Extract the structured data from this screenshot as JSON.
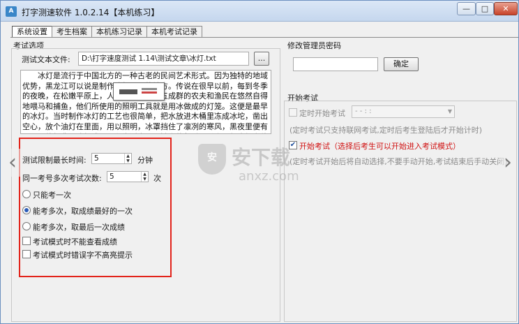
{
  "window": {
    "app_icon": "A",
    "title": "打字测速软件 1.0.2.14【本机练习】",
    "minimize_glyph": "—",
    "maximize_glyph": "□",
    "close_glyph": "✕"
  },
  "tabs": [
    "系统设置",
    "考生档案",
    "本机练习记录",
    "本机考试记录"
  ],
  "exam_options": {
    "section_title": "考试选项",
    "test_file_label": "测试文本文件:",
    "test_file_value": "D:\\打字速度测试 1.14\\测试文章\\冰灯.txt",
    "browse_label": "...",
    "text_body": "冰灯是流行于中国北方的一种古老的民间艺术形式。因为独特的地域优势，黑龙江可以说是制作冰灯最早的地方。传说在很早以前，每到冬季的夜晚，在松嫩平原上，人们总会看到三五成群的农夫和渔民在悠然自得地喂马和捕鱼，他们所使用的照明工具就是用冰做成的灯笼。这便是最早的冰灯。当时制作冰灯的工艺也很简单，把水放进木桶里冻成冰坨，凿出空心，放个油灯在里面，用以照明，冰罩挡住了凛冽的寒风，黑夜里便有了不灭的灯盏，冰灯成了人们生活中不可缺少的帮手。后来，每逢新春佳节和上元之夜，人们又把它加以装饰，而成为供人观赏的独特的艺术表现形",
    "time_limit_label": "测试限制最长时间:",
    "time_limit_value": "5",
    "time_limit_unit": "分钟",
    "attempts_label": "同一考号多次考试次数:",
    "attempts_value": "5",
    "attempts_unit": "次",
    "radio_options": [
      {
        "label": "只能考一次",
        "checked": false
      },
      {
        "label": "能考多次，取成绩最好的一次",
        "checked": true
      },
      {
        "label": "能考多次，取最后一次成绩",
        "checked": false
      }
    ],
    "checkboxes": [
      {
        "label": "考试模式时不能查看成绩",
        "checked": false
      },
      {
        "label": "考试模式时错误字不高亮提示",
        "checked": false
      }
    ]
  },
  "admin": {
    "section_title": "修改管理员密码",
    "password_value": "",
    "confirm_label": "确定"
  },
  "start_exam": {
    "section_title": "开始考试",
    "timed_start_label": "定时开始考试",
    "timed_value": "- -  : :",
    "timed_note": "(定时考试只支持联网考试,定时后考生登陆后才开始计时)",
    "start_exam_label": "开始考试（选择后考生可以开始进入考试模式）",
    "start_exam_checked": true,
    "start_note": "(定时考试开始后将自动选择,不要手动开始,考试结束后手动关闭)"
  },
  "watermark": {
    "shield_text": "安",
    "cn_text": "安下载",
    "en_text": "anxz.com"
  },
  "nav": {
    "left": "‹",
    "right": "›"
  },
  "colors": {
    "highlight_border": "#e2231a",
    "accent": "#2a5cb8",
    "red_text": "#d01010"
  }
}
